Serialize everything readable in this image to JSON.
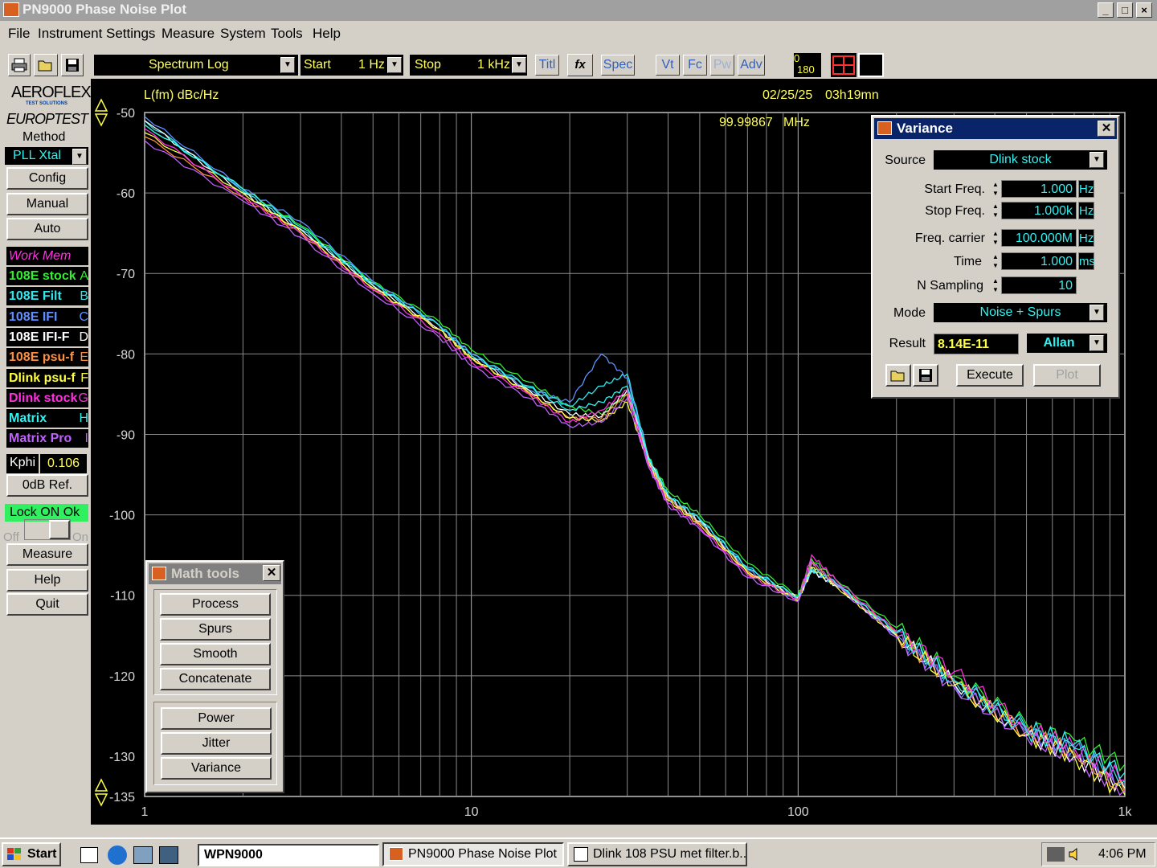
{
  "window": {
    "title": "PN9000 Phase Noise Plot",
    "buttons": [
      "_",
      "□",
      "×"
    ]
  },
  "menu": [
    {
      "label": "File"
    },
    {
      "label": "Instrument"
    },
    {
      "label": "Settings"
    },
    {
      "label": "Measure"
    },
    {
      "label": "System"
    },
    {
      "label": "Tools"
    },
    {
      "label": "Help"
    }
  ],
  "toolbar": {
    "mode": "Spectrum Log",
    "start_label": "Start",
    "start_value": "1 Hz",
    "stop_label": "Stop",
    "stop_value": "1 kHz",
    "titl": "Titl",
    "fx": "fx",
    "spec": "Spec",
    "vt": "Vt",
    "fc": "Fc",
    "pw": "Pw",
    "adv": "Adv",
    "angle_top": "0",
    "angle_bottom": "180"
  },
  "left_panel": {
    "brand1": "AEROFLEX",
    "brand1_sub": "TEST SOLUTIONS",
    "brand2": "EUROPTEST",
    "method_label": "Method",
    "method_value": "PLL Xtal",
    "config": "Config",
    "manual": "Manual",
    "auto": "Auto",
    "work_mem": "Work Mem",
    "memories": [
      {
        "label": "108E stock",
        "key": "A",
        "color": "#30f030"
      },
      {
        "label": "108E Filt",
        "key": "B",
        "color": "#30e8f0"
      },
      {
        "label": "108E IFI",
        "key": "C",
        "color": "#6090ff"
      },
      {
        "label": "108E IFI-F",
        "key": "D",
        "color": "#ffffff"
      },
      {
        "label": "108E psu-f",
        "key": "E",
        "color": "#ff9040"
      },
      {
        "label": "Dlink psu-f",
        "key": "F",
        "color": "#ffff40"
      },
      {
        "label": "Dlink stock",
        "key": "G",
        "color": "#ff30e0"
      },
      {
        "label": "Matrix",
        "key": "H",
        "color": "#30f0f0"
      },
      {
        "label": "Matrix Pro",
        "key": "I",
        "color": "#c060ff"
      }
    ],
    "kphi_label": "Kphi",
    "kphi_value": "0.106",
    "odb_ref": "0dB Ref.",
    "lock": "Lock ON Ok",
    "off": "Off",
    "on": "On",
    "measure": "Measure",
    "help": "Help",
    "quit": "Quit"
  },
  "plot_header": {
    "ylabel": "L(fm) dBc/Hz",
    "date": "02/25/25",
    "time": "03h19mn",
    "carrier": "99.99867",
    "carrier_unit": "MHz"
  },
  "math_tools": {
    "title": "Math tools",
    "group1": [
      "Process",
      "Spurs",
      "Smooth",
      "Concatenate"
    ],
    "group2": [
      "Power",
      "Jitter",
      "Variance"
    ]
  },
  "variance": {
    "title": "Variance",
    "source_label": "Source",
    "source_value": "Dlink stock",
    "start_label": "Start Freq.",
    "start_value": "1.000",
    "start_unit": "Hz",
    "stop_label": "Stop Freq.",
    "stop_value": "1.000k",
    "stop_unit": "Hz",
    "carrier_label": "Freq. carrier",
    "carrier_value": "100.000M",
    "carrier_unit": "Hz",
    "time_label": "Time",
    "time_value": "1.000",
    "time_unit": "ms",
    "nsamp_label": "N Sampling",
    "nsamp_value": "10",
    "mode_label": "Mode",
    "mode_value": "Noise + Spurs",
    "result_label": "Result",
    "result_value": "8.14E-11",
    "result_type": "Allan",
    "execute": "Execute",
    "plot": "Plot"
  },
  "taskbar": {
    "start": "Start",
    "address": "WPN9000",
    "task1": "PN9000 Phase Noise Plot",
    "task2": "Dlink 108 PSU met filter.b...",
    "clock": "4:06 PM"
  },
  "chart_data": {
    "type": "line",
    "x_scale": "log",
    "xlim": [
      1,
      1000
    ],
    "ylim": [
      -135,
      -50
    ],
    "xticks": [
      "1",
      "10",
      "100",
      "1k"
    ],
    "yticks": [
      "-50",
      "-60",
      "-70",
      "-80",
      "-90",
      "-100",
      "-110",
      "-120",
      "-130",
      "-135"
    ],
    "ylabel": "L(fm) dBc/Hz",
    "grid": true,
    "x": [
      1,
      2,
      3,
      5,
      8,
      10,
      15,
      20,
      25,
      30,
      35,
      40,
      50,
      70,
      100,
      110,
      130,
      200,
      300,
      500,
      700,
      1000
    ],
    "series": [
      {
        "name": "108E stock",
        "color": "#30f030",
        "values": [
          -51.5,
          -59.5,
          -64,
          -71,
          -76,
          -79.5,
          -83.5,
          -86.5,
          -87.5,
          -85,
          -93,
          -97,
          -100,
          -106,
          -110,
          -105.5,
          -108,
          -114,
          -120,
          -126,
          -128,
          -131
        ]
      },
      {
        "name": "108E Filt",
        "color": "#30e8f0",
        "values": [
          -51,
          -59.8,
          -64.5,
          -71.5,
          -76.5,
          -80,
          -84,
          -86.5,
          -84,
          -82.5,
          -93,
          -97.5,
          -100.5,
          -106.5,
          -110.3,
          -106.5,
          -108.5,
          -114.5,
          -120.5,
          -126.5,
          -128.5,
          -133
        ]
      },
      {
        "name": "108E IFI",
        "color": "#6090ff",
        "values": [
          -50.5,
          -59.5,
          -63.5,
          -71,
          -76.5,
          -80,
          -84.5,
          -86,
          -80,
          -83,
          -93.5,
          -98,
          -101,
          -106.8,
          -110.6,
          -107,
          -108.8,
          -115,
          -121,
          -127,
          -129,
          -133.5
        ]
      },
      {
        "name": "108E IFI-F",
        "color": "#ffffff",
        "values": [
          -51,
          -60,
          -64.5,
          -71.5,
          -77,
          -80.5,
          -84.5,
          -87.5,
          -87.8,
          -84.5,
          -93.2,
          -97.8,
          -100.8,
          -107,
          -110.4,
          -107,
          -108.7,
          -115,
          -121,
          -127.5,
          -130,
          -134
        ]
      },
      {
        "name": "108E psu-f",
        "color": "#ff9040",
        "values": [
          -53,
          -60.5,
          -65,
          -72,
          -77,
          -80.5,
          -85,
          -88,
          -88,
          -85,
          -93.5,
          -98,
          -101,
          -107,
          -110.5,
          -106,
          -108.5,
          -114.8,
          -120.8,
          -127,
          -129.5,
          -134.5
        ]
      },
      {
        "name": "Dlink psu-f",
        "color": "#ffff40",
        "values": [
          -52.5,
          -60,
          -64.8,
          -71.8,
          -77,
          -80.5,
          -84.8,
          -88,
          -88.3,
          -86,
          -93.8,
          -98.2,
          -101.2,
          -107.2,
          -110.7,
          -106.5,
          -108.8,
          -115,
          -121.2,
          -127.3,
          -130,
          -134.8
        ]
      },
      {
        "name": "Dlink stock",
        "color": "#ff30e0",
        "values": [
          -52,
          -60.5,
          -65,
          -72,
          -77.5,
          -81,
          -85,
          -88.5,
          -87,
          -84.5,
          -94,
          -98.5,
          -101.5,
          -107.5,
          -110.5,
          -105,
          -108,
          -114.5,
          -119.5,
          -126.5,
          -129,
          -133
        ]
      },
      {
        "name": "Matrix",
        "color": "#30f0f0",
        "values": [
          -51.5,
          -59.5,
          -64.2,
          -71.2,
          -76.5,
          -80.2,
          -84.2,
          -87,
          -86,
          -84,
          -93.3,
          -97.5,
          -100.6,
          -106.7,
          -110.2,
          -106.8,
          -108.4,
          -114.7,
          -120.6,
          -126.8,
          -129,
          -132
        ]
      },
      {
        "name": "Matrix Pro",
        "color": "#c060ff",
        "values": [
          -53.5,
          -61,
          -65.5,
          -72.5,
          -78,
          -81.5,
          -85.5,
          -89,
          -88.5,
          -85.5,
          -94.2,
          -98.8,
          -101.8,
          -107.8,
          -110.8,
          -105.8,
          -108.6,
          -115.2,
          -121.4,
          -127.6,
          -130.4,
          -134.2
        ]
      }
    ]
  }
}
